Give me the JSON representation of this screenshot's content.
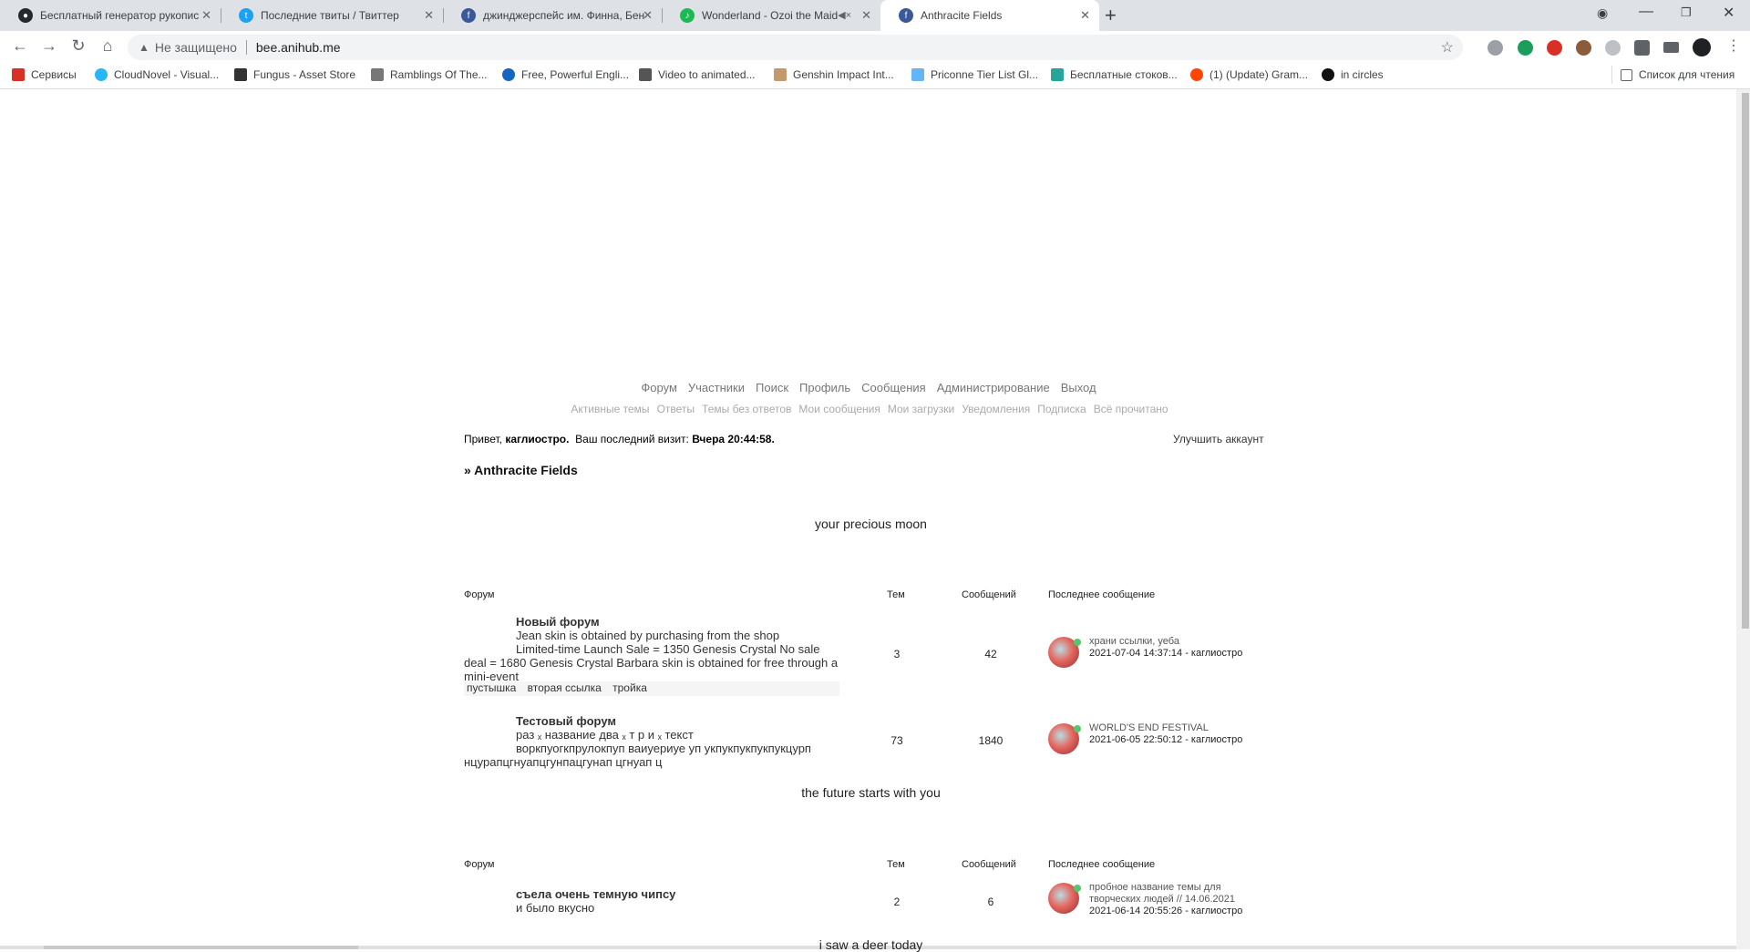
{
  "browser": {
    "tabs": [
      {
        "title": "Бесплатный генератор рукопис",
        "icon": "github-icon",
        "color": "#24292e"
      },
      {
        "title": "Последние твиты / Твиттер",
        "icon": "twitter-icon",
        "color": "#1da1f2"
      },
      {
        "title": "джинджерспейс им. Финна, Бен",
        "icon": "forum-icon",
        "color": "#3b5998"
      },
      {
        "title": "Wonderland - Ozoi the Maid",
        "icon": "spotify-icon",
        "color": "#1db954"
      },
      {
        "title": "Anthracite Fields",
        "icon": "forum-icon",
        "color": "#3b5998",
        "active": true
      }
    ],
    "address": {
      "security": "Не защищено",
      "url": "bee.anihub.me"
    },
    "bookmarks": [
      {
        "label": "Сервисы",
        "icon": "apps-icon"
      },
      {
        "label": "CloudNovel - Visual...",
        "icon": "cloud-icon"
      },
      {
        "label": "Fungus - Asset Store",
        "icon": "unity-icon"
      },
      {
        "label": "Ramblings Of The...",
        "icon": "blog-icon"
      },
      {
        "label": "Free, Powerful Engli...",
        "icon": "dictionary-icon"
      },
      {
        "label": "Video to animated...",
        "icon": "video-icon"
      },
      {
        "label": "Genshin Impact Int...",
        "icon": "game-icon"
      },
      {
        "label": "Priconne Tier List Gl...",
        "icon": "game-icon"
      },
      {
        "label": "Бесплатные стоков...",
        "icon": "stock-icon"
      },
      {
        "label": "(1) (Update) Gram...",
        "icon": "reddit-icon"
      },
      {
        "label": "in circles",
        "icon": "circle-icon"
      }
    ],
    "reading_list": "Список для чтения"
  },
  "forum": {
    "nav": [
      "Форум",
      "Участники",
      "Поиск",
      "Профиль",
      "Сообщения",
      "Администрирование",
      "Выход"
    ],
    "subnav": [
      "Активные темы",
      "Ответы",
      "Темы без ответов",
      "Мои сообщения",
      "Мои загрузки",
      "Уведомления",
      "Подписка",
      "Всё прочитано"
    ],
    "greeting": {
      "hello": "Привет,",
      "user": "каглиостро.",
      "last_visit_label": "Ваш последний визит:",
      "last_visit": "Вчера 20:44:58."
    },
    "upgrade": "Улучшить аккаунт",
    "breadcrumb": "» Anthracite Fields",
    "headers": {
      "forum": "Форум",
      "topics": "Тем",
      "posts": "Сообщений",
      "last": "Последнее сообщение"
    },
    "categories": [
      {
        "title": "your precious moon",
        "forums": [
          {
            "name": "Новый форум",
            "desc1": "Jean skin is obtained by purchasing from the shop",
            "desc2": "Limited-time Launch Sale = 1350 Genesis Crystal No sale deal = 1680 Genesis Crystal Barbara skin is obtained for free through a mini-event",
            "subforums": [
              "пустышка",
              "вторая ссылка",
              "тройка"
            ],
            "topics": "3",
            "posts": "42",
            "last_title": "храни ссылки, уеба",
            "last_meta": "2021-07-04 14:37:14 - каглиостро"
          },
          {
            "name": "Тестовый форум",
            "desc1": "раз ₓ название два ₓ т р и ₓ текст",
            "desc2": "воркпуогкпрулокпуп ваиуериуе уп укпукпукпукпукцурп нцурапцгнуапцгунпацгунап цгнуап ц",
            "topics": "73",
            "posts": "1840",
            "last_title": "WORLD'S END FESTIVAL",
            "last_meta": "2021-06-05 22:50:12 - каглиостро"
          }
        ]
      },
      {
        "title": "the future starts with you",
        "forums": [
          {
            "name": "съела очень темную чипсу",
            "desc1": "и было вкусно",
            "topics": "2",
            "posts": "6",
            "last_title": "пробное название темы для творческих людей // 14.06.2021",
            "last_meta": "2021-06-14 20:55:26 - каглиостро"
          }
        ]
      },
      {
        "title": "i saw a deer today"
      }
    ]
  }
}
